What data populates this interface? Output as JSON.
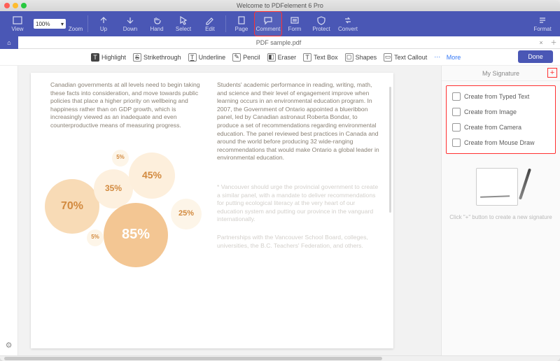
{
  "window": {
    "title": "Welcome to PDFelement 6 Pro"
  },
  "toolbar": {
    "view": "View",
    "zoom": "Zoom",
    "zoom_value": "100%",
    "up": "Up",
    "down": "Down",
    "hand": "Hand",
    "select": "Select",
    "edit": "Edit",
    "page": "Page",
    "comment": "Comment",
    "form": "Form",
    "protect": "Protect",
    "convert": "Convert",
    "format": "Format"
  },
  "file": {
    "name": "PDF sample.pdf"
  },
  "anno": {
    "highlight": "Highlight",
    "strike": "Strikethrough",
    "underline": "Underline",
    "pencil": "Pencil",
    "eraser": "Eraser",
    "textbox": "Text Box",
    "shapes": "Shapes",
    "callout": "Text Callout",
    "more": "More",
    "done": "Done"
  },
  "doc": {
    "left_para": "Canadian governments at all levels need to begin taking these facts into consideration, and move towards public policies that place a higher priority on wellbeing and happiness rather than on GDP growth, which is increasingly viewed as an inadequate and even counterproductive means of measuring progress.",
    "right_para": "Students' academic performance in reading, writing, math, and science and their level of engagement improve when learning occurs in an environmental education program. In 2007, the Government of Ontario appointed a blueribbon panel, led by Canadian astronaut Roberta Bondar, to produce a set of recommendations regarding environmental education. The panel reviewed best practices in Canada and around the world before producing 32 wide-ranging recommendations that would make Ontario a global leader in environmental education.",
    "r2": "* Vancouver should urge the provincial government to create a similar panel, with a mandate to deliver recommendations for putting ecological literacy at the very heart of our education system and putting our province in the vanguard internationally.",
    "r3": "Partnerships with the Vancouver School Board, colleges, universities, the B.C. Teachers' Federation, and others."
  },
  "bubbles": {
    "b1": "70%",
    "b2": "35%",
    "b3": "45%",
    "b4": "85%",
    "b5": "25%",
    "b6": "5%",
    "b7": "5%",
    "colors": {
      "dark": "#f3c693",
      "mid": "#f8dbb6",
      "light": "#fdefdc",
      "vlight": "#fdf5e8"
    }
  },
  "sig": {
    "header": "My Signature",
    "items": [
      "Create from Typed Text",
      "Create from Image",
      "Create from Camera",
      "Create from Mouse Draw"
    ],
    "hint": "Click \"+\" button to create a new signature"
  }
}
